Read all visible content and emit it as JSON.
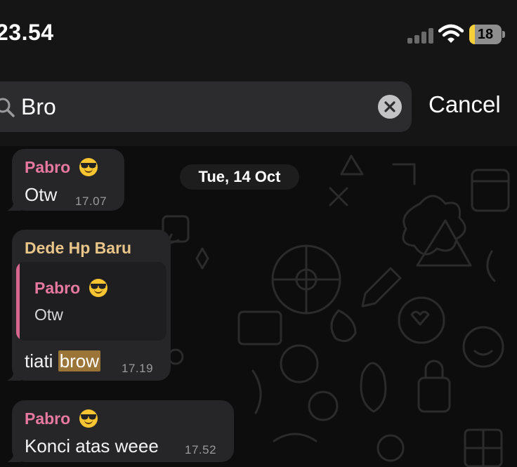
{
  "status_bar": {
    "time": "23.54",
    "battery_level": "18",
    "battery_fraction": 0.18,
    "icons": [
      "cellular-signal-icon",
      "wifi-icon",
      "battery-icon"
    ]
  },
  "search": {
    "query": "Bro",
    "cancel_label": "Cancel",
    "icons": [
      "search-icon",
      "clear-icon"
    ]
  },
  "chat": {
    "date_separator": "Tue, 14 Oct",
    "messages": [
      {
        "sender": "Pabro",
        "sender_emoji": "smiling-face-with-sunglasses",
        "text": "Otw",
        "time": "17.07"
      },
      {
        "sender": "Dede Hp Baru",
        "reply_to": {
          "sender": "Pabro",
          "sender_emoji": "smiling-face-with-sunglasses",
          "text": "Otw"
        },
        "text_before": "tiati ",
        "text_match": "brow",
        "time": "17.19"
      },
      {
        "sender": "Pabro",
        "sender_emoji": "smiling-face-with-sunglasses",
        "text": "Konci atas weee",
        "time": "17.52"
      }
    ]
  },
  "colors": {
    "sender_pabro": "#e7799e",
    "sender_dede": "#e9c58a",
    "reply_bar": "#d9668d",
    "search_highlight": "#9b7537",
    "bubble": "#262628",
    "battery_fill": "#f5cf3a"
  }
}
